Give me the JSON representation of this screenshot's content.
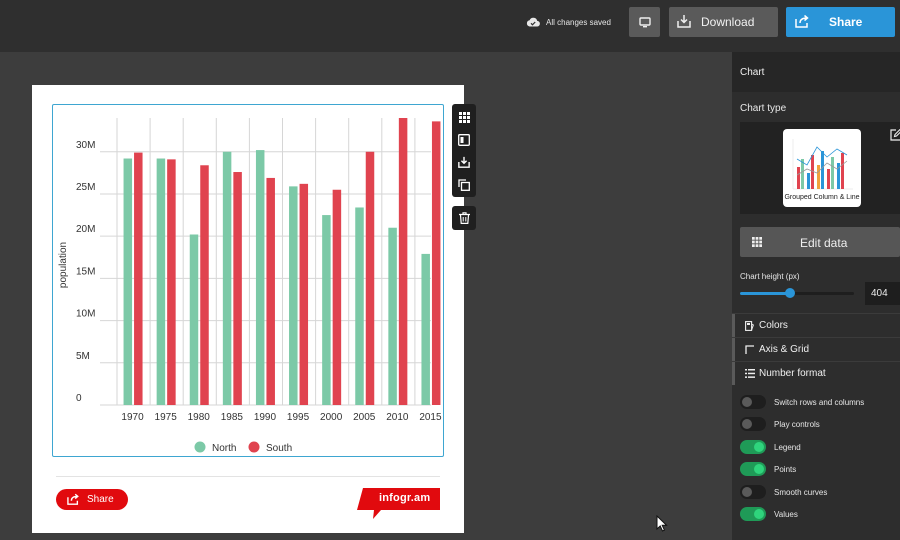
{
  "topbar": {
    "status": "All changes saved",
    "download_label": "Download",
    "share_label": "Share",
    "share_color": "#2a95d8"
  },
  "canvas": {
    "share_label": "Share",
    "brand_label": "infogr.am",
    "brand_color": "#e10a0e",
    "float_tools": [
      "grid-icon",
      "responsive-icon",
      "download-icon",
      "duplicate-icon"
    ],
    "delete_tool": "trash-icon"
  },
  "chart_data": {
    "type": "bar",
    "categories": [
      "1970",
      "1975",
      "1980",
      "1985",
      "1990",
      "1995",
      "2000",
      "2005",
      "2010",
      "2015"
    ],
    "series": [
      {
        "name": "North",
        "color": "#7cc9a7",
        "values": [
          29.2,
          29.2,
          20.2,
          30.0,
          30.2,
          25.9,
          22.5,
          23.4,
          21.0,
          17.9
        ]
      },
      {
        "name": "South",
        "color": "#e0434f",
        "values": [
          29.9,
          29.1,
          28.4,
          27.6,
          26.9,
          26.2,
          25.5,
          30.0,
          34.0,
          33.6
        ]
      }
    ],
    "yticks": [
      "0",
      "5M",
      "10M",
      "15M",
      "20M",
      "25M",
      "30M"
    ],
    "ylabel": "population",
    "ylim": [
      0,
      34
    ],
    "legend": "bottom-center",
    "grid": true
  },
  "panel": {
    "title": "Chart",
    "chart_type_label": "Chart type",
    "chart_type_name": "Grouped Column & Line",
    "edit_data_label": "Edit data",
    "chart_height_label": "Chart height (px)",
    "chart_height_value": "404",
    "chart_height_fraction": 0.44,
    "sections": [
      "Colors",
      "Axis & Grid",
      "Number format"
    ],
    "toggles": [
      {
        "label": "Switch rows and columns",
        "on": false
      },
      {
        "label": "Play controls",
        "on": false
      },
      {
        "label": "Legend",
        "on": true
      },
      {
        "label": "Points",
        "on": true
      },
      {
        "label": "Smooth curves",
        "on": false
      },
      {
        "label": "Values",
        "on": true
      }
    ]
  }
}
